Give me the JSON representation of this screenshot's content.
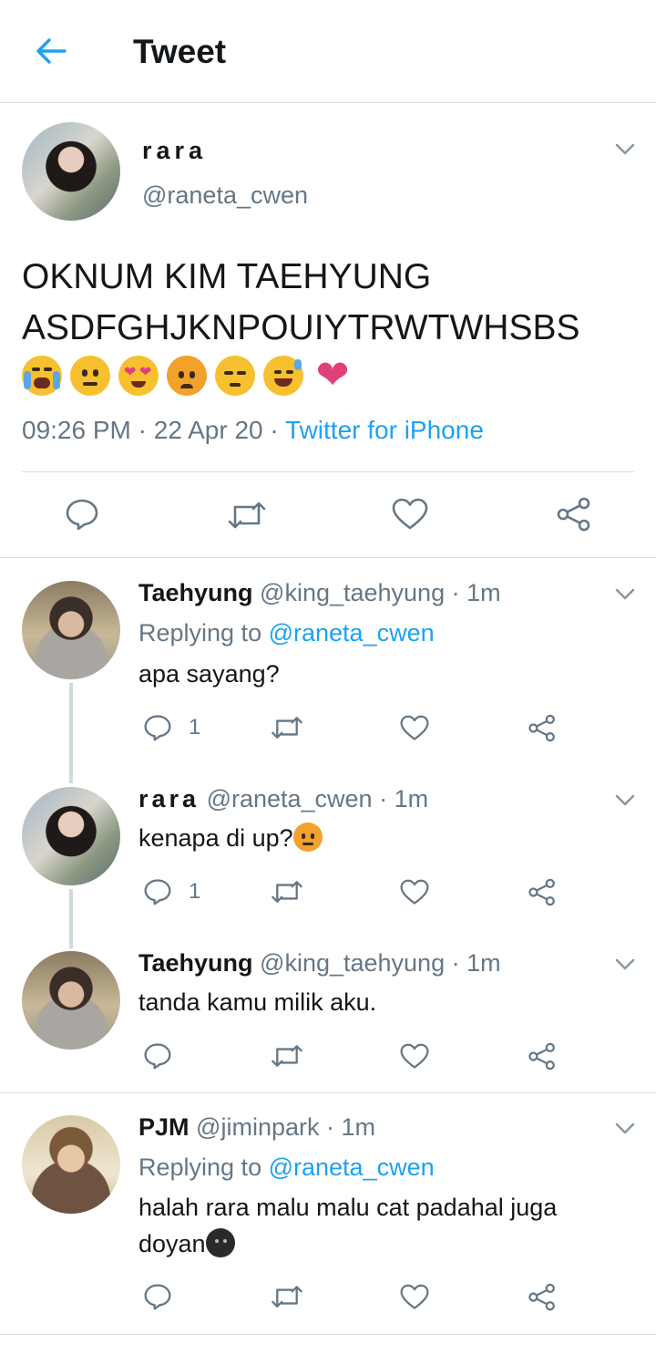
{
  "header": {
    "title": "Tweet"
  },
  "main_tweet": {
    "name": "rara",
    "handle": "@raneta_cwen",
    "text_line1": "OKNUM KIM TAEHYUNG",
    "text_line2": "ASDFGHJKNPOUIYTRWTWHSBS",
    "emojis": [
      "loudly-crying-face",
      "neutral-face",
      "smiling-face-with-heart-eyes",
      "pouting-face",
      "unamused-face",
      "grinning-sweat-face",
      "heavy-heart"
    ],
    "time": "09:26 PM",
    "date": "22 Apr 20",
    "source": "Twitter for iPhone"
  },
  "replies": [
    {
      "name": "Taehyung",
      "handle": "@king_taehyung",
      "age": "1m",
      "replying_prefix": "Replying to",
      "replying_to": "@raneta_cwen",
      "text": "apa sayang?",
      "reply_count": "1"
    },
    {
      "name": "rara",
      "handle": "@raneta_cwen",
      "age": "1m",
      "text": "kenapa di up?",
      "text_emoji": "pouting-face",
      "reply_count": "1"
    },
    {
      "name": "Taehyung",
      "handle": "@king_taehyung",
      "age": "1m",
      "text": "tanda kamu milik aku."
    },
    {
      "name": "PJM",
      "handle": "@jiminpark",
      "age": "1m",
      "replying_prefix": "Replying to",
      "replying_to": "@raneta_cwen",
      "text_line1": "halah rara malu malu cat padahal juga",
      "text_line2": "doyan",
      "text_emoji": "new-moon-face"
    }
  ],
  "colors": {
    "accent": "#1da1f2",
    "secondary_text": "#657786",
    "primary_text": "#14171a",
    "divider": "#d6dde2"
  }
}
